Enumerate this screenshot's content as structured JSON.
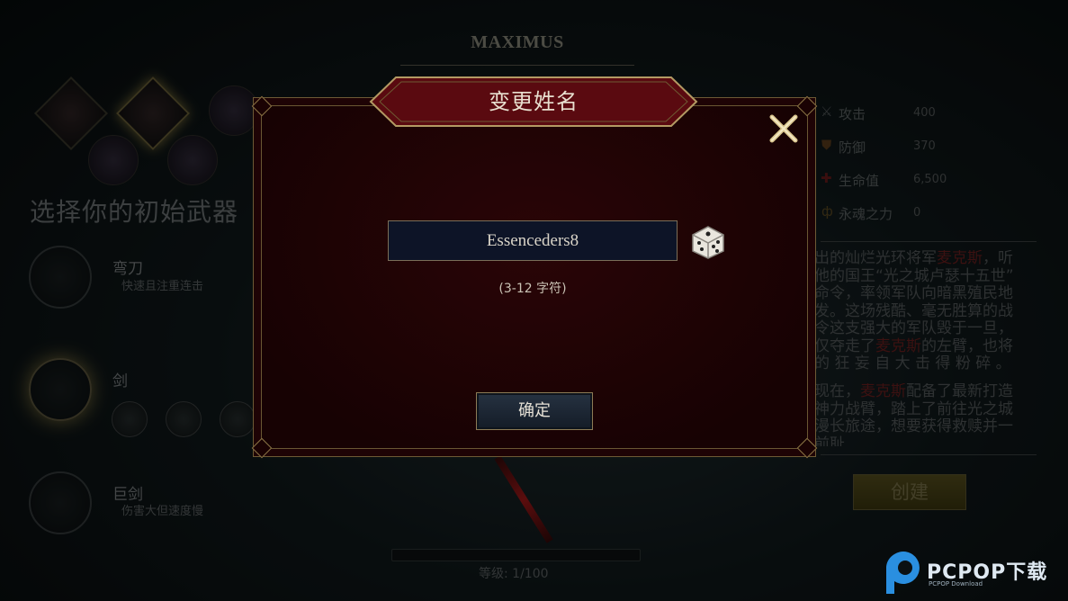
{
  "hero": {
    "name": "MAXIMUS"
  },
  "weapons_section": {
    "title": "选择你的初始武器",
    "weapons": [
      {
        "name": "弯刀",
        "desc": "快速且注重连击"
      },
      {
        "name": "剑",
        "desc": ""
      },
      {
        "name": "巨剑",
        "desc": "伤害大但速度慢"
      }
    ]
  },
  "stats": [
    {
      "icon": "sword-icon",
      "label": "攻击",
      "value": "400"
    },
    {
      "icon": "shield-icon",
      "label": "防御",
      "value": "370"
    },
    {
      "icon": "cross-icon",
      "label": "生命值",
      "value": "6,500"
    },
    {
      "icon": "soul-icon",
      "label": "永魂之力",
      "value": "0"
    }
  ],
  "story": {
    "lines": [
      "出的灿烂光环将军麦克斯，听",
      "他的国王“光之城卢瑟十五世”",
      "命令，率领军队向暗黑殖民地",
      "发。这场残酷、毫无胜算的战",
      "令这支强大的军队毁于一旦，",
      "仅夺走了麦克斯的左臂，也将",
      "的 狂 妄 自 大 击 得 粉 碎 。"
    ],
    "lines2": [
      "现在，麦克斯配备了最新打造",
      "神力战臂，踏上了前往光之城",
      "漫长旅途，想要获得救赎并一",
      "前耻"
    ],
    "highlight": "麦克斯"
  },
  "create_button": "创建",
  "level": {
    "text": "等级: 1/100"
  },
  "dialog": {
    "title": "变更姓名",
    "name_value": "Essenceders8",
    "hint": "(3-12 字符)",
    "confirm": "确定"
  },
  "watermark": {
    "brand": "PCPOP下载",
    "sub": "PCPOP Download"
  },
  "colors": {
    "dialog_bg": "#1e0305",
    "gold_border": "#8a7445",
    "input_bg": "#0d1427"
  }
}
